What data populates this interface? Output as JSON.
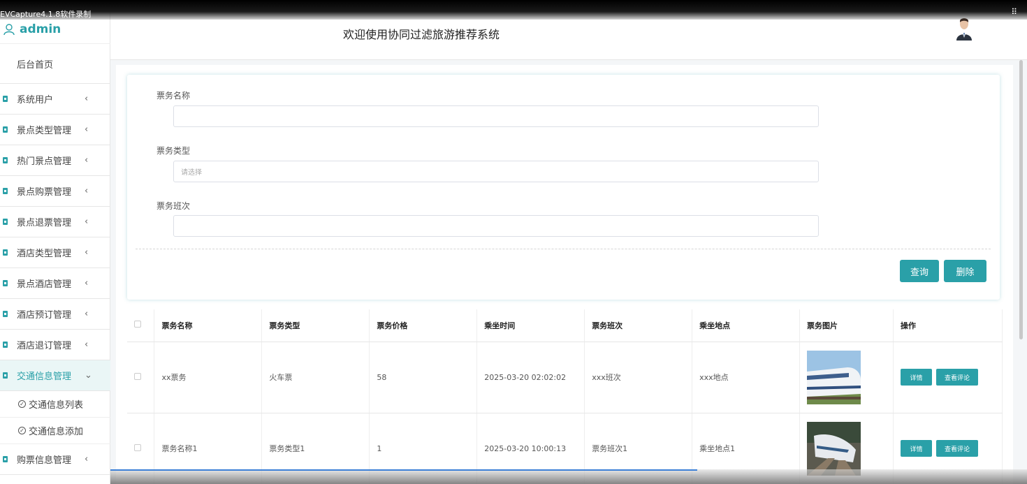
{
  "recorder_label": "EVCapture4.1.8软件录制",
  "brand": {
    "name": "admin"
  },
  "header": {
    "title": "欢迎使用协同过滤旅游推荐系统"
  },
  "sidebar": {
    "home": "后台首页",
    "items": [
      {
        "label": "系统用户"
      },
      {
        "label": "景点类型管理"
      },
      {
        "label": "热门景点管理"
      },
      {
        "label": "景点购票管理"
      },
      {
        "label": "景点退票管理"
      },
      {
        "label": "酒店类型管理"
      },
      {
        "label": "景点酒店管理"
      },
      {
        "label": "酒店预订管理"
      },
      {
        "label": "酒店退订管理"
      },
      {
        "label": "交通信息管理"
      }
    ],
    "subitems": [
      {
        "label": "交通信息列表"
      },
      {
        "label": "交通信息添加"
      }
    ],
    "after": {
      "label": "购票信息管理"
    }
  },
  "search": {
    "name_label": "票务名称",
    "name_value": "",
    "type_label": "票务类型",
    "type_placeholder": "请选择",
    "class_label": "票务班次",
    "class_value": "",
    "query_button": "查询",
    "delete_button": "删除"
  },
  "table": {
    "headers": [
      "票务名称",
      "票务类型",
      "票务价格",
      "乘坐时间",
      "票务班次",
      "乘坐地点",
      "票务图片",
      "操作"
    ],
    "rows": [
      {
        "name": "xx票务",
        "type": "火车票",
        "price": "58",
        "time": "2025-03-20 02:02:02",
        "class": "xxx班次",
        "place": "xxx地点"
      },
      {
        "name": "票务名称1",
        "type": "票务类型1",
        "price": "1",
        "time": "2025-03-20 10:00:13",
        "class": "票务班次1",
        "place": "乘坐地点1"
      }
    ],
    "detail_button": "详情",
    "review_button": "查看评论"
  },
  "colors": {
    "accent": "#2aa0a8",
    "border": "#e6e6e6"
  }
}
